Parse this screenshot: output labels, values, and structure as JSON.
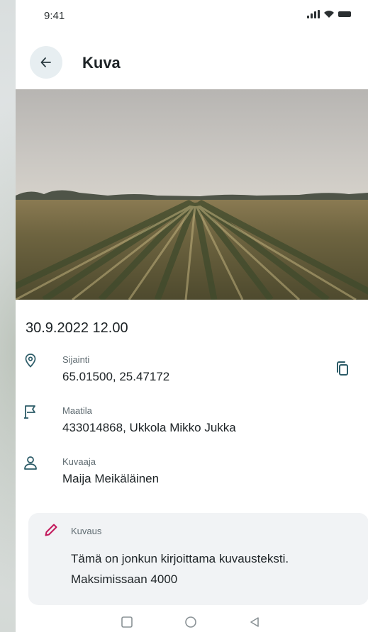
{
  "status_bar": {
    "time": "9:41"
  },
  "header": {
    "title": "Kuva"
  },
  "photo": {
    "subject": "cornfield"
  },
  "details": {
    "datetime": "30.9.2022 12.00",
    "location": {
      "label": "Sijainti",
      "value": "65.01500, 25.47172",
      "icon": "location-pin-icon"
    },
    "farm": {
      "label": "Maatila",
      "value": "433014868, Ukkola Mikko Jukka",
      "icon": "farm-flag-icon"
    },
    "photographer": {
      "label": "Kuvaaja",
      "value": "Maija Meikäläinen",
      "icon": "person-icon"
    }
  },
  "description": {
    "label": "Kuvaus",
    "text": "Tämä on jonkun kirjoittama kuvausteksti. Maksimissaan 4000",
    "icon": "pencil-icon"
  },
  "colors": {
    "accent_icon": "#2d5c68",
    "pencil": "#c2185b",
    "back_button_bg": "#e7eef1",
    "card_bg": "#f1f3f5"
  }
}
